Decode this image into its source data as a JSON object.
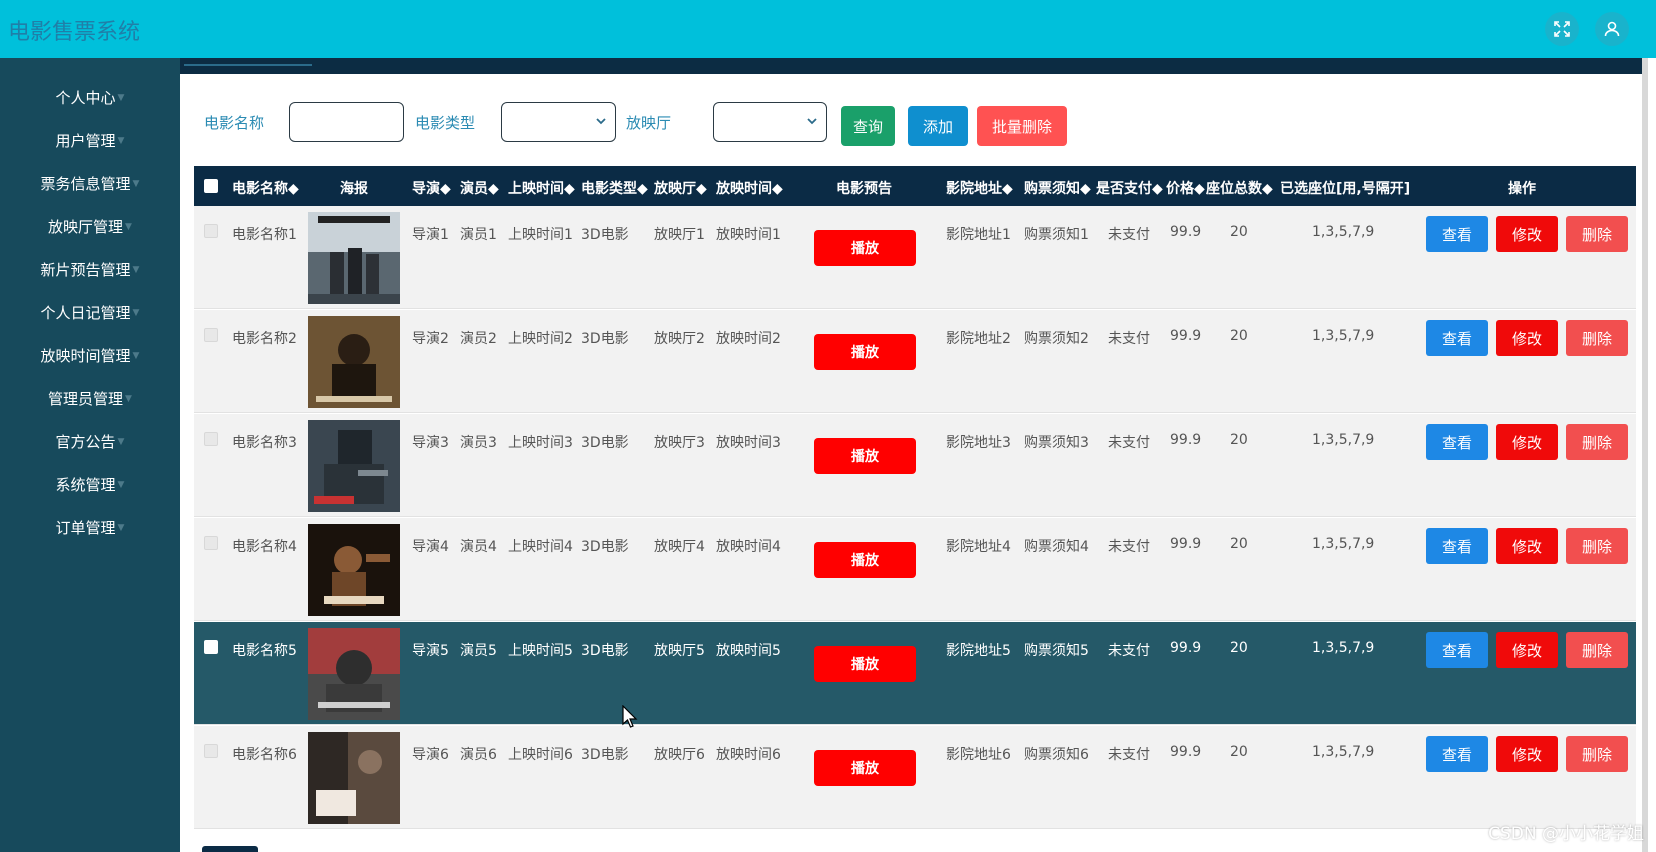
{
  "header": {
    "title": "电影售票系统",
    "icons": [
      "fullscreen-icon",
      "user-icon"
    ]
  },
  "sidebar": {
    "items": [
      {
        "label": "个人中心"
      },
      {
        "label": "用户管理"
      },
      {
        "label": "票务信息管理"
      },
      {
        "label": "放映厅管理"
      },
      {
        "label": "新片预告管理"
      },
      {
        "label": "个人日记管理"
      },
      {
        "label": "放映时间管理"
      },
      {
        "label": "管理员管理"
      },
      {
        "label": "官方公告"
      },
      {
        "label": "系统管理"
      },
      {
        "label": "订单管理"
      }
    ]
  },
  "search": {
    "name_label": "电影名称",
    "type_label": "电影类型",
    "hall_label": "放映厅",
    "name_value": "",
    "type_value": "",
    "hall_value": "",
    "query_button": "查询",
    "add_button": "添加",
    "batch_delete_button": "批量删除"
  },
  "table": {
    "headers": {
      "name": "电影名称",
      "poster": "海报",
      "director": "导演",
      "actor": "演员",
      "release": "上映时间",
      "type": "电影类型",
      "hall": "放映厅",
      "showtime": "放映时间",
      "trailer": "电影预告",
      "address": "影院地址",
      "notice": "购票须知",
      "paid": "是否支付",
      "price": "价格",
      "seats": "座位总数",
      "selected": "已选座位[用,号隔开]",
      "actions": "操作"
    },
    "rows": [
      {
        "name": "电影名称1",
        "director": "导演1",
        "actor": "演员1",
        "release": "上映时间1",
        "type": "3D电影",
        "hall": "放映厅1",
        "showtime": "放映时间1",
        "play": "播放",
        "address": "影院地址1",
        "notice": "购票须知1",
        "paid": "未支付",
        "price": "99.9",
        "seats": "20",
        "selected": "1,3,5,7,9",
        "view": "查看",
        "edit": "修改",
        "delete": "删除"
      },
      {
        "name": "电影名称2",
        "director": "导演2",
        "actor": "演员2",
        "release": "上映时间2",
        "type": "3D电影",
        "hall": "放映厅2",
        "showtime": "放映时间2",
        "play": "播放",
        "address": "影院地址2",
        "notice": "购票须知2",
        "paid": "未支付",
        "price": "99.9",
        "seats": "20",
        "selected": "1,3,5,7,9",
        "view": "查看",
        "edit": "修改",
        "delete": "删除"
      },
      {
        "name": "电影名称3",
        "director": "导演3",
        "actor": "演员3",
        "release": "上映时间3",
        "type": "3D电影",
        "hall": "放映厅3",
        "showtime": "放映时间3",
        "play": "播放",
        "address": "影院地址3",
        "notice": "购票须知3",
        "paid": "未支付",
        "price": "99.9",
        "seats": "20",
        "selected": "1,3,5,7,9",
        "view": "查看",
        "edit": "修改",
        "delete": "删除"
      },
      {
        "name": "电影名称4",
        "director": "导演4",
        "actor": "演员4",
        "release": "上映时间4",
        "type": "3D电影",
        "hall": "放映厅4",
        "showtime": "放映时间4",
        "play": "播放",
        "address": "影院地址4",
        "notice": "购票须知4",
        "paid": "未支付",
        "price": "99.9",
        "seats": "20",
        "selected": "1,3,5,7,9",
        "view": "查看",
        "edit": "修改",
        "delete": "删除"
      },
      {
        "name": "电影名称5",
        "director": "导演5",
        "actor": "演员5",
        "release": "上映时间5",
        "type": "3D电影",
        "hall": "放映厅5",
        "showtime": "放映时间5",
        "play": "播放",
        "address": "影院地址5",
        "notice": "购票须知5",
        "paid": "未支付",
        "price": "99.9",
        "seats": "20",
        "selected": "1,3,5,7,9",
        "view": "查看",
        "edit": "修改",
        "delete": "删除"
      },
      {
        "name": "电影名称6",
        "director": "导演6",
        "actor": "演员6",
        "release": "上映时间6",
        "type": "3D电影",
        "hall": "放映厅6",
        "showtime": "放映时间6",
        "play": "播放",
        "address": "影院地址6",
        "notice": "购票须知6",
        "paid": "未支付",
        "price": "99.9",
        "seats": "20",
        "selected": "1,3,5,7,9",
        "view": "查看",
        "edit": "修改",
        "delete": "删除"
      }
    ]
  },
  "watermark": "CSDN @小小花学姐",
  "colors": {
    "header": "#00c0db",
    "sidebar": "#174a5c",
    "table_header": "#0b2b45",
    "row_highlight": "#255968",
    "query": "#1aa06a",
    "add": "#0f8fcf",
    "batch_delete": "#ff5252",
    "play": "#ff0000",
    "view": "#1e88e5",
    "edit": "#f00a0a",
    "delete": "#f24f4f"
  }
}
